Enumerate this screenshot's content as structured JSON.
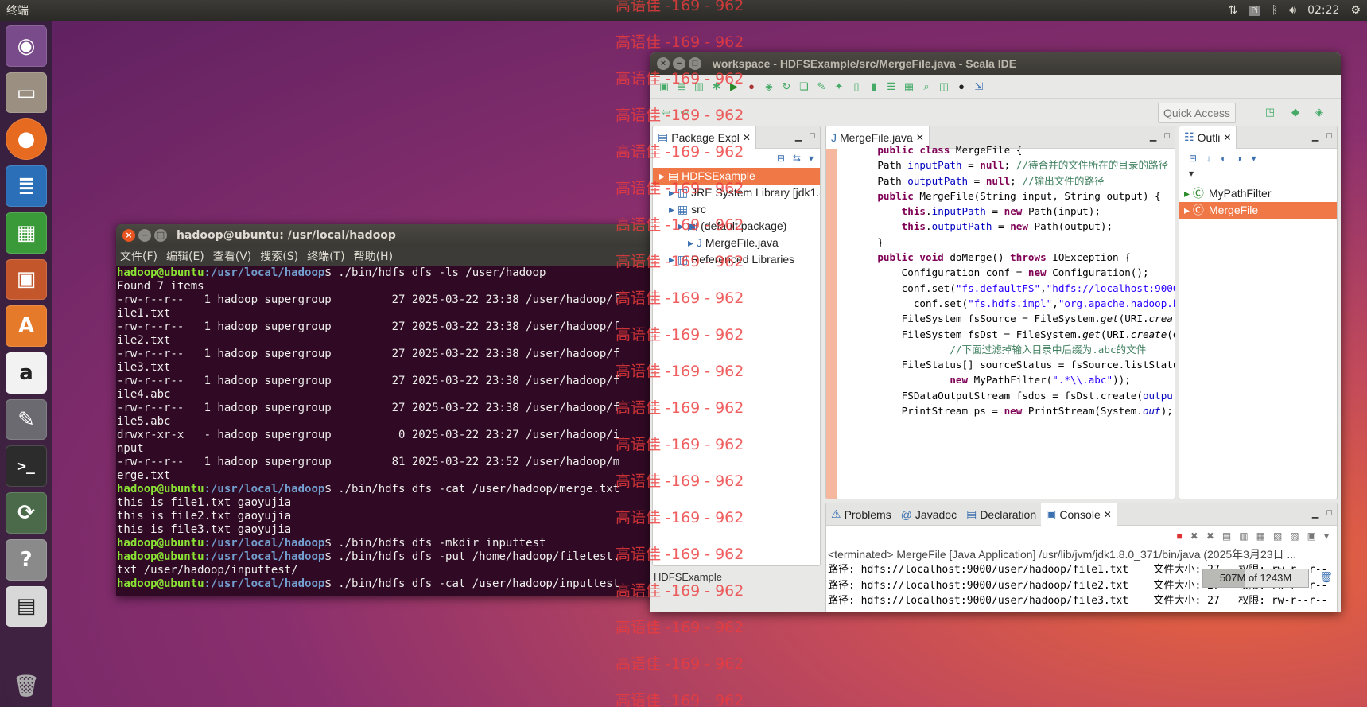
{
  "top_panel": {
    "app_name": "终端",
    "clock": "02:22",
    "badge": "Pi"
  },
  "launcher": {
    "items": [
      "ubuntu-dash",
      "files",
      "firefox",
      "writer",
      "calc",
      "impress",
      "software",
      "amazon",
      "settings",
      "terminal",
      "updater",
      "help",
      "save",
      "trash"
    ]
  },
  "watermark": {
    "text": "高语佳 -169 - 962"
  },
  "terminal": {
    "title": "hadoop@ubuntu: /usr/local/hadoop",
    "menu": [
      "文件(F)",
      "编辑(E)",
      "查看(V)",
      "搜索(S)",
      "终端(T)",
      "帮助(H)"
    ],
    "prompt_user": "hadoop@ubuntu",
    "prompt_path": ":/usr/local/hadoop",
    "lines": [
      {
        "type": "cmd",
        "text": "$ ./bin/hdfs dfs -ls /user/hadoop"
      },
      {
        "type": "out",
        "text": "Found 7 items"
      },
      {
        "type": "out",
        "text": "-rw-r--r--   1 hadoop supergroup         27 2025-03-22 23:38 /user/hadoop/f"
      },
      {
        "type": "out",
        "text": "ile1.txt"
      },
      {
        "type": "out",
        "text": "-rw-r--r--   1 hadoop supergroup         27 2025-03-22 23:38 /user/hadoop/f"
      },
      {
        "type": "out",
        "text": "ile2.txt"
      },
      {
        "type": "out",
        "text": "-rw-r--r--   1 hadoop supergroup         27 2025-03-22 23:38 /user/hadoop/f"
      },
      {
        "type": "out",
        "text": "ile3.txt"
      },
      {
        "type": "out",
        "text": "-rw-r--r--   1 hadoop supergroup         27 2025-03-22 23:38 /user/hadoop/f"
      },
      {
        "type": "out",
        "text": "ile4.abc"
      },
      {
        "type": "out",
        "text": "-rw-r--r--   1 hadoop supergroup         27 2025-03-22 23:38 /user/hadoop/f"
      },
      {
        "type": "out",
        "text": "ile5.abc"
      },
      {
        "type": "out",
        "text": "drwxr-xr-x   - hadoop supergroup          0 2025-03-22 23:27 /user/hadoop/i"
      },
      {
        "type": "out",
        "text": "nput"
      },
      {
        "type": "out",
        "text": "-rw-r--r--   1 hadoop supergroup         81 2025-03-22 23:52 /user/hadoop/m"
      },
      {
        "type": "out",
        "text": "erge.txt"
      },
      {
        "type": "cmd",
        "text": "$ ./bin/hdfs dfs -cat /user/hadoop/merge.txt"
      },
      {
        "type": "out",
        "text": "this is file1.txt gaoyujia"
      },
      {
        "type": "out",
        "text": "this is file2.txt gaoyujia"
      },
      {
        "type": "out",
        "text": "this is file3.txt gaoyujia"
      },
      {
        "type": "cmd",
        "text": "$ ./bin/hdfs dfs -mkdir inputtest"
      },
      {
        "type": "cmd",
        "text": "$ ./bin/hdfs dfs -put /home/hadoop/filetest."
      },
      {
        "type": "out",
        "text": "txt /user/hadoop/inputtest/"
      },
      {
        "type": "cmd",
        "text": "$ ./bin/hdfs dfs -cat /user/hadoop/inputtest"
      }
    ]
  },
  "ide": {
    "title": "workspace - HDFSExample/src/MergeFile.java - Scala IDE",
    "quick_access": "Quick Access",
    "package_explorer": {
      "tab": "Package Expl",
      "items": [
        {
          "label": "HDFSExample",
          "indent": 0,
          "selected": true
        },
        {
          "label": "JRE System Library [jdk1.8",
          "indent": 1
        },
        {
          "label": "src",
          "indent": 1
        },
        {
          "label": "(default package)",
          "indent": 2
        },
        {
          "label": "MergeFile.java",
          "indent": 3
        },
        {
          "label": "Referenced Libraries",
          "indent": 1
        }
      ]
    },
    "editor": {
      "tab": "MergeFile.java",
      "header_partial": "public class MergeFile {"
    },
    "outline": {
      "tab": "Outli",
      "items": [
        {
          "label": "MyPathFilter",
          "selected": false
        },
        {
          "label": "MergeFile",
          "selected": true
        }
      ]
    },
    "bottom_tabs": [
      "Problems",
      "Javadoc",
      "Declaration",
      "Console"
    ],
    "console": {
      "header": "<terminated> MergeFile [Java Application] /usr/lib/jvm/jdk1.8.0_371/bin/java (2025年3月23日 ...",
      "rows": [
        "路径: hdfs://localhost:9000/user/hadoop/file1.txt    文件大小: 27   权限: rw-r--r--",
        "路径: hdfs://localhost:9000/user/hadoop/file2.txt    文件大小: 27   权限: rw-r--r--",
        "路径: hdfs://localhost:9000/user/hadoop/file3.txt    文件大小: 27   权限: rw-r--r--"
      ]
    },
    "status": {
      "project": "HDFSExample",
      "heap": "507M of 1243M"
    }
  }
}
